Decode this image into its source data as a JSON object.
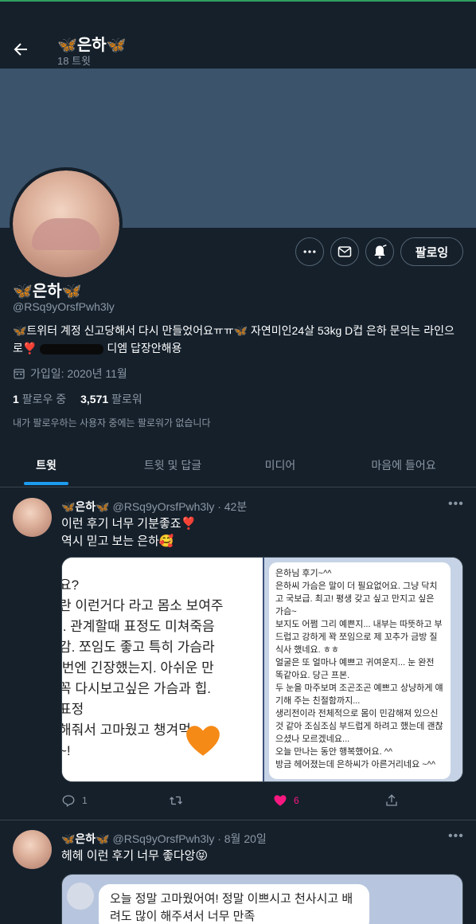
{
  "header": {
    "back_label": "←",
    "name": "🦋은하🦋",
    "tweet_count": "18 트윗"
  },
  "profile": {
    "name": "🦋은하🦋",
    "handle": "@RSq9yOrsfPwh3ly",
    "bio_part1": "🦋트위터 계정 신고당해서 다시 만들었어요ㅠㅠ🦋 자연미인24살 53kg D컵 은하 문의는 라인으로❣️",
    "bio_part2": "디엠 답장안해용",
    "joined": "가입일: 2020년 11월",
    "following_count": "1",
    "following_label": "팔로우 중",
    "followers_count": "3,571",
    "followers_label": "팔로워",
    "no_mutual": "내가 팔로우하는 사용자 중에는 팔로워가 없습니다",
    "follow_button": "팔로잉"
  },
  "tabs": [
    "트윗",
    "트윗 및 답글",
    "미디어",
    "마음에 들어요"
  ],
  "tweets": [
    {
      "name": "🦋은하🦋",
      "handle_time": "@RSq9yOrsfPwh3ly · 42분",
      "line1": "이런 후기 너무 기분좋죠❣️",
      "line2": "역시 믿고 보는 은하🥰",
      "image_left_lines": [
        "요?",
        "란 이런거다 라고 몸소 보여주",
        ".. 관계할때 표정도 미쳐죽음",
        "감. 쪼임도 좋고 특히 가슴라",
        "l번엔 긴장했는지. 아쉬운 만",
        "꼭 다시보고싶은 가슴과 힙.",
        "표정",
        "해줘서 고마웠고      챙겨먹",
        "~!"
      ],
      "image_right_text": [
        "은하님 후기~^^",
        "은하씨 가슴은 말이 더 필요없어요. 그냥 닥치고 국보급. 최고! 평생 갖고 싶고 만지고 싶은 가슴~",
        "보지도 어쩜 그리 예쁜지... 내부는 따뜻하고 부드럽고 강하게 꽉 쪼임으로 제 꼬추가 금방 질식사 했네요. ㅎㅎ",
        "얼굴은 또 얼마나 예쁘고 귀여운지... 눈 완전 똑같아요. 당근 프본.",
        "두 눈을 마주보며 조곤조곤 예쁘고 상냥하게 얘기해 주는 친절함까지...",
        "생리전이라 전체적으로 몸이 민감해져 있으신것 같아 조심조심 부드럽게 하려고 했는데 괜찮으셨나 모르겠네요...",
        "오늘 만나는 동안 행복했어요. ^^",
        "방금 헤어졌는데 은하씨가 아른거리네요 ~^^"
      ],
      "reply_count": "1",
      "retweet_count": "",
      "like_count": "6"
    },
    {
      "name": "🦋은하🦋",
      "handle_time": "@RSq9yOrsfPwh3ly · 8월 20일",
      "line1": "헤헤 이런 후기 너무 좋다앙😝",
      "image_text": "오늘 정말 고마웠어여! 정말 이쁘시고 천사시고 배려도 많이 해주셔서 너무 만족"
    }
  ],
  "colors": {
    "background": "#15202b",
    "banner": "#3b536b",
    "accent": "#1d9bf0",
    "muted": "#8b98a5",
    "like": "#f91880",
    "border": "#38444d"
  },
  "icons": [
    "back-arrow-icon",
    "more-icon",
    "mail-icon",
    "bell-plus-icon",
    "calendar-icon",
    "reply-icon",
    "retweet-icon",
    "heart-icon",
    "share-icon",
    "orange-heart-icon",
    "user-icon"
  ]
}
